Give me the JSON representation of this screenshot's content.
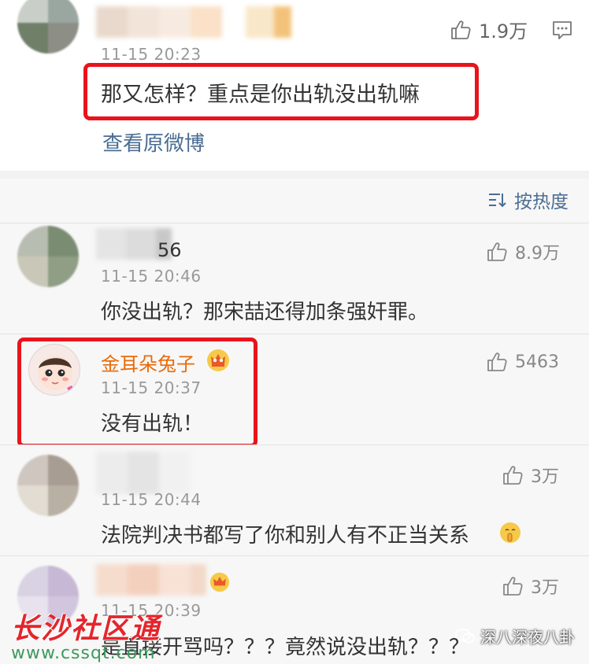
{
  "comments": {
    "top": {
      "time": "11-15 20:23",
      "likes": "1.9万",
      "text": "那又怎样？重点是你出轨没出轨嘛",
      "link": "查看原微博"
    },
    "sort_label": "按热度",
    "items": [
      {
        "name_suffix": "56",
        "time": "11-15 20:46",
        "likes": "8.9万",
        "text": "你没出轨？那宋喆还得加条强奸罪。"
      },
      {
        "name": "金耳朵兔子",
        "time": "11-15 20:37",
        "likes": "5463",
        "text": "没有出轨！"
      },
      {
        "time": "11-15 20:44",
        "likes": "3万",
        "text": "法院判决书都写了你和别人有不正当关系"
      },
      {
        "time": "11-15 20:39",
        "likes": "3万",
        "text": "是直接开骂吗？？？竟然说没出轨？？？"
      }
    ]
  },
  "watermark": {
    "site_name": "长沙社区通",
    "site_url": "www.cssqt.com",
    "account": "深八深夜八卦"
  },
  "colors": {
    "red_box": "#e9141b",
    "link_blue": "#4a6d93",
    "vip_orange": "#e86b0a"
  }
}
